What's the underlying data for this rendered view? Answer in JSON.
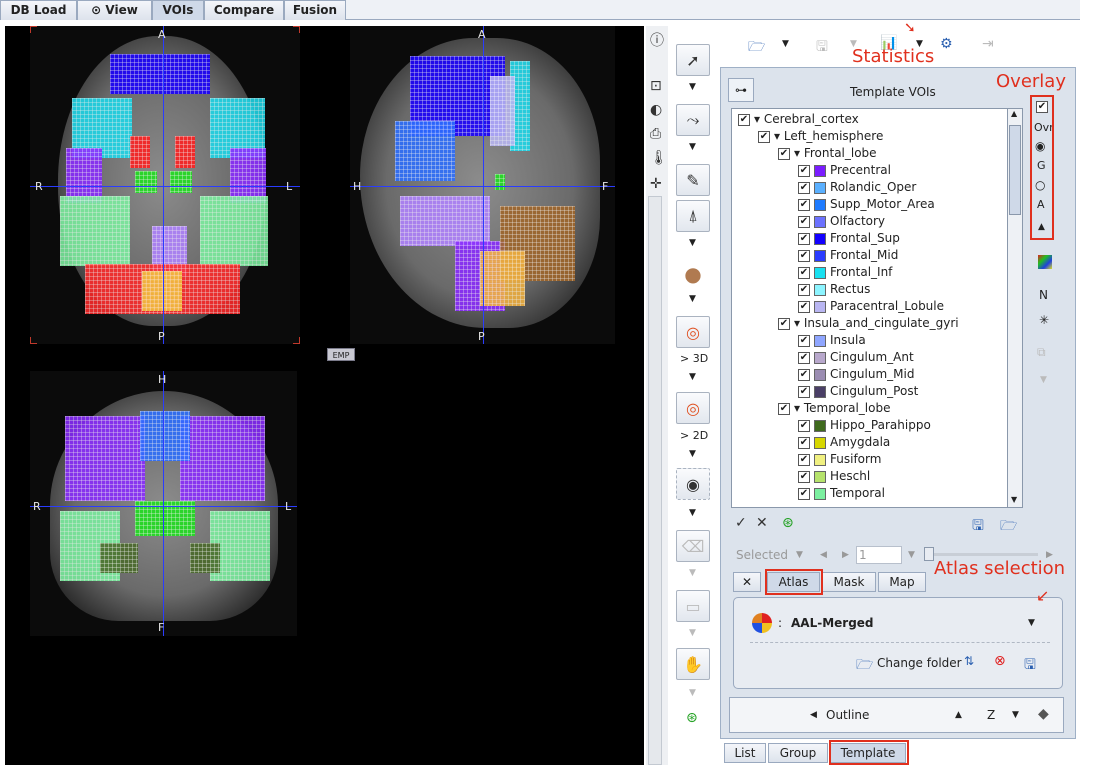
{
  "tabs": [
    "DB Load",
    "View",
    "VOIs",
    "Compare",
    "Fusion"
  ],
  "active_tab": "VOIs",
  "viewer": {
    "axial": {
      "top": "A",
      "bottom": "P",
      "left": "R",
      "right": "L"
    },
    "sagittal": {
      "top": "A",
      "bottom": "P",
      "left": "H",
      "right": "F"
    },
    "coronal": {
      "top": "H",
      "bottom": "F",
      "left": "R",
      "right": "L"
    },
    "emp_badge": "EMP"
  },
  "tool_labels": {
    "three_d": "> 3D",
    "two_d": "> 2D"
  },
  "template_header": "Template VOIs",
  "tree": [
    {
      "label": "Cerebral_cortex",
      "level": 0,
      "color": ""
    },
    {
      "label": "Left_hemisphere",
      "level": 1,
      "color": ""
    },
    {
      "label": "Frontal_lobe",
      "level": 2,
      "color": ""
    },
    {
      "label": "Precentral",
      "level": 3,
      "color": "#7a1cff"
    },
    {
      "label": "Rolandic_Oper",
      "level": 3,
      "color": "#5ab0ff"
    },
    {
      "label": "Supp_Motor_Area",
      "level": 3,
      "color": "#1e7bff"
    },
    {
      "label": "Olfactory",
      "level": 3,
      "color": "#6c72ff"
    },
    {
      "label": "Frontal_Sup",
      "level": 3,
      "color": "#1200ff"
    },
    {
      "label": "Frontal_Mid",
      "level": 3,
      "color": "#2a3cff"
    },
    {
      "label": "Frontal_Inf",
      "level": 3,
      "color": "#18e0f0"
    },
    {
      "label": "Rectus",
      "level": 3,
      "color": "#8cf4ff"
    },
    {
      "label": "Paracentral_Lobule",
      "level": 3,
      "color": "#b9b6f2"
    },
    {
      "label": "Insula_and_cingulate_gyri",
      "level": 2,
      "color": ""
    },
    {
      "label": "Insula",
      "level": 3,
      "color": "#8fa6ff"
    },
    {
      "label": "Cingulum_Ant",
      "level": 3,
      "color": "#b8a8cc"
    },
    {
      "label": "Cingulum_Mid",
      "level": 3,
      "color": "#9b8db2"
    },
    {
      "label": "Cingulum_Post",
      "level": 3,
      "color": "#4a3f66"
    },
    {
      "label": "Temporal_lobe",
      "level": 2,
      "color": ""
    },
    {
      "label": "Hippo_Parahippo",
      "level": 3,
      "color": "#3f6a1e"
    },
    {
      "label": "Amygdala",
      "level": 3,
      "color": "#d6d600"
    },
    {
      "label": "Fusiform",
      "level": 3,
      "color": "#f0f080"
    },
    {
      "label": "Heschl",
      "level": 3,
      "color": "#b6e36c"
    },
    {
      "label": "Temporal",
      "level": 3,
      "color": "#7cf0a0"
    }
  ],
  "selection": {
    "label": "Selected",
    "value": "1"
  },
  "sub_tabs": {
    "close": "✕",
    "atlas": "Atlas",
    "mask": "Mask",
    "map": "Map"
  },
  "atlas": {
    "name": "AAL-Merged",
    "separator": ":",
    "change_folder": "Change folder"
  },
  "outline": {
    "label": "Outline",
    "z": "Z"
  },
  "bottom_tabs": [
    "List",
    "Group",
    "Template"
  ],
  "overlay_panel": {
    "ovr": "Ovr",
    "g": "G",
    "a": "A",
    "n": "N"
  },
  "annotations": {
    "statistics": "Statistics",
    "overlay": "Overlay",
    "atlas_selection": "Atlas selection"
  }
}
